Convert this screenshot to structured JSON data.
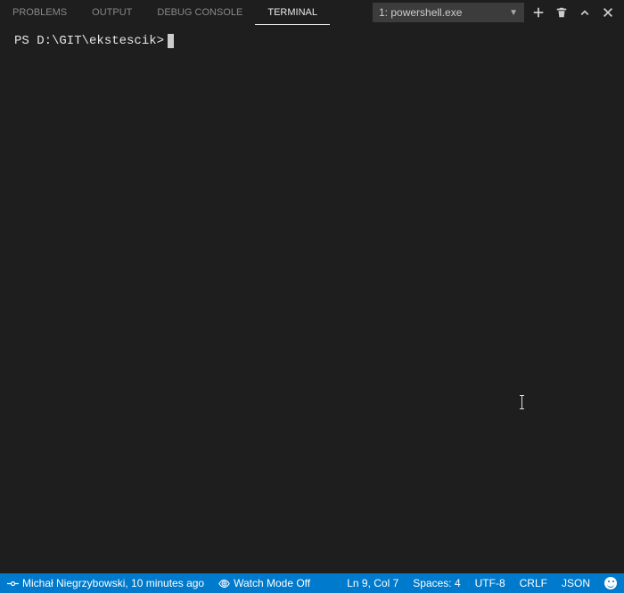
{
  "panel": {
    "tabs": [
      {
        "label": "PROBLEMS",
        "active": false
      },
      {
        "label": "OUTPUT",
        "active": false
      },
      {
        "label": "DEBUG CONSOLE",
        "active": false
      },
      {
        "label": "TERMINAL",
        "active": true
      }
    ],
    "terminal_select": "1: powershell.exe"
  },
  "terminal": {
    "prompt": "PS D:\\GIT\\ekstescik>"
  },
  "statusbar": {
    "blame": "Michał Niegrzybowski, 10 minutes ago",
    "watch": "Watch Mode Off",
    "cursor": "Ln 9, Col 7",
    "indent": "Spaces: 4",
    "encoding": "UTF-8",
    "eol": "CRLF",
    "language": "JSON"
  }
}
